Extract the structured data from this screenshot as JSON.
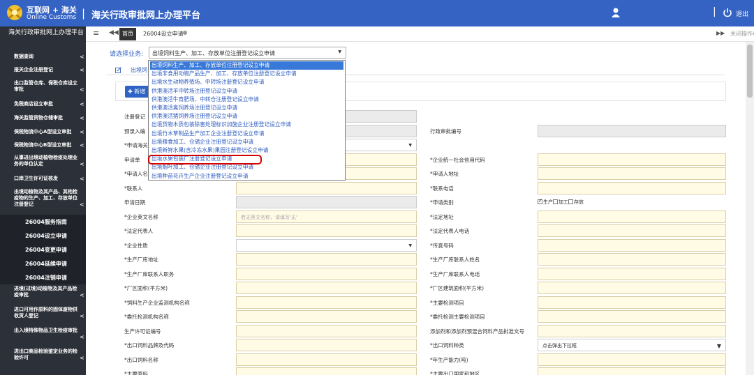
{
  "header": {
    "brand_cn": "互联网 + 海关",
    "brand_en": "Online Customs",
    "separator": "|",
    "title": "海关行政审批网上办理平台",
    "logout": "退出",
    "icons": [
      "logo-icon",
      "user-icon",
      "power-icon"
    ]
  },
  "sidebar": {
    "title": "海关行政审批网上办理平台",
    "items": [
      {
        "label": "数据查询",
        "arrow": "<"
      },
      {
        "label": "报关企业注册登记",
        "arrow": "<"
      },
      {
        "label": "出口监管仓库、保税仓库设立审批",
        "arrow": "<"
      },
      {
        "label": "免税商店设立审批",
        "arrow": "<"
      },
      {
        "label": "海关监管货物仓储审批",
        "arrow": "<"
      },
      {
        "label": "保税物流中心A型设立审批",
        "arrow": "<"
      },
      {
        "label": "保税物流中心B型设立审批",
        "arrow": "<"
      },
      {
        "label": "从事进出境动植物检疫处理业务的单位认定",
        "arrow": "<"
      },
      {
        "label": "口岸卫生许可证核发",
        "arrow": "<"
      },
      {
        "label": "出境动植物及其产品、其他检疫物的生产、加工、存放单位注册登记",
        "arrow": "<"
      }
    ],
    "subitems": [
      "26004服务指南",
      "26004设立申请",
      "26004变更申请",
      "26004延续申请",
      "26004注销申请"
    ],
    "items2": [
      {
        "label": "进境(过境)动植物及其产品检疫审批",
        "arrow": "<"
      },
      {
        "label": "进口可用作原料的固体废物供收货人登记",
        "arrow": "<"
      },
      {
        "label": "出入境特殊物品卫生检疫审批",
        "arrow": "<"
      },
      {
        "label": "进出口商品检验鉴定业务的检验许可",
        "arrow": "<"
      }
    ]
  },
  "tabbar": {
    "menu": "≡",
    "back": "◀◀",
    "home": "首页",
    "app_tab": "26004设立申请",
    "forward": "▶▶",
    "close_ops": "关闭操作▾"
  },
  "biz_select": {
    "label": "请选择业务:",
    "value": "出境饲料生产、加工、存放单位注册登记设立申请",
    "caret": "▼"
  },
  "form_tab": "出境饲",
  "new_button": "✚ 新增",
  "form": {
    "rows": [
      {
        "left_label": "注册登记",
        "left_type": "grey",
        "right_label": "",
        "right_type": "none"
      },
      {
        "left_label": "预录入编",
        "left_type": "grey",
        "right_label": "行政审批编号",
        "right_type": "grey"
      },
      {
        "left_label": "*申请海关",
        "left_type": "white_dd",
        "right_label": "",
        "right_type": "none"
      },
      {
        "left_label": "申请单",
        "left_type": "yellow",
        "right_label": "*企业统一社会信用代码",
        "right_type": "yellow"
      },
      {
        "left_label": "*申请人名",
        "left_type": "yellow",
        "right_label": "*申请人地址",
        "right_type": "yellow"
      },
      {
        "left_label": "*联系人",
        "left_type": "yellow",
        "right_label": "*联系电话",
        "right_type": "yellow"
      },
      {
        "left_label": "申请日期",
        "left_type": "grey",
        "right_label": "*申请类别",
        "right_type": "checks"
      },
      {
        "left_label": "*企业英文名称",
        "left_type": "yellow_ph",
        "right_label": "*法定地址",
        "right_type": "yellow"
      },
      {
        "left_label": "*法定代表人",
        "left_type": "yellow",
        "right_label": "*法定代表人电话",
        "right_type": "yellow"
      },
      {
        "left_label": "*企业性质",
        "left_type": "white_dd",
        "right_label": "*传真号码",
        "right_type": "yellow"
      },
      {
        "left_label": "*生产厂库地址",
        "left_type": "yellow",
        "right_label": "*生产厂库联系人姓名",
        "right_type": "yellow"
      },
      {
        "left_label": "*生产厂库联系人职务",
        "left_type": "yellow",
        "right_label": "*生产厂库联系人电话",
        "right_type": "yellow"
      },
      {
        "left_label": "*厂区面积(平方米)",
        "left_type": "yellow",
        "right_label": "*厂区建筑面积(平方米)",
        "right_type": "yellow"
      },
      {
        "left_label": "*饲料生产企业监测机构名称",
        "left_type": "yellow",
        "right_label": "*主要检测项目",
        "right_type": "yellow"
      },
      {
        "left_label": "*委托检测机构名称",
        "left_type": "yellow",
        "right_label": "*委托检测主要检测项目",
        "right_type": "yellow"
      },
      {
        "left_label": "生产许可证编号",
        "left_type": "yellow",
        "right_label": "添加剂和添加剂预混合饲料产品批准文号",
        "right_type": "yellow"
      },
      {
        "left_label": "*出口饲料品牌及代码",
        "left_type": "yellow",
        "right_label": "*出口饲料种类",
        "right_type": "white_dd_text"
      },
      {
        "left_label": "*出口饲料名称",
        "left_type": "yellow",
        "right_label": "*年生产能力(吨)",
        "right_type": "yellow"
      },
      {
        "left_label": "*主要原料",
        "left_type": "yellow",
        "right_label": "*主要出口国家和地区",
        "right_type": "yellow"
      }
    ],
    "english_placeholder": "若无英文名称，请填写'无'",
    "dropdown_caret": "▼",
    "category_options": [
      "生产",
      "加工",
      "存放"
    ],
    "category_checked": [
      true,
      false,
      false
    ],
    "feed_type_placeholder": "点击弹出下拉框"
  },
  "dropdown": {
    "options": [
      "出境饲料生产、加工、存放单位注册登记设立申请",
      "出境非食用动物产品生产、加工、存放单位注册登记设立申请",
      "出境水生动物养殖场、中转场注册登记设立申请",
      "供港澳活羊中转场注册登记设立申请",
      "供港澳活牛育肥场、中转仓注册登记设立申请",
      "供港澳活禽饲养场注册登记设立申请",
      "供港澳活猪饲养场注册登记设立申请",
      "出境货物木质包装除害处理标识加施企业注册登记设立申请",
      "出境竹木草制品生产加工企业注册登记设立申请",
      "出境粮食加工、仓储企业注册登记设立申请",
      "出境新鲜水果(含冷冻水果)果园注册登记设立申请",
      "出境水果包装厂注册登记设立申请",
      "出境烟叶加工、仓储企业注册登记设立申请",
      "出境种苗花卉生产企业注册登记设立申请"
    ],
    "selected_index": 0,
    "highlighted_index": 11
  }
}
